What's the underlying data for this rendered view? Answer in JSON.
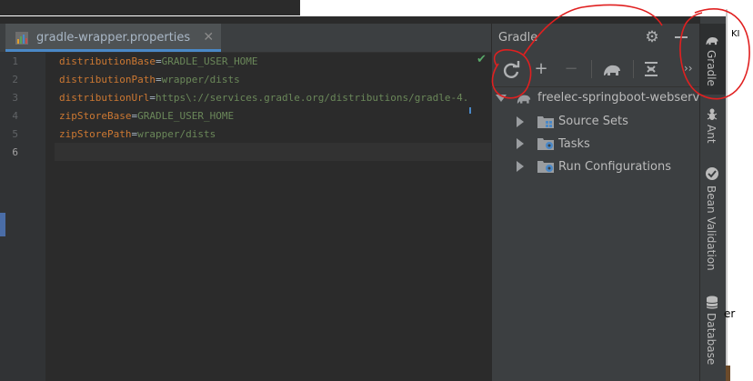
{
  "editor": {
    "tab_label": "gradle-wrapper.properties",
    "lines": [
      {
        "num": "1",
        "key": "distributionBase",
        "eq": "=",
        "value": "GRADLE_USER_HOME"
      },
      {
        "num": "2",
        "key": "distributionPath",
        "eq": "=",
        "value": "wrapper/dists"
      },
      {
        "num": "3",
        "key": "distributionUrl",
        "eq": "=",
        "value": "https\\://services.gradle.org/distributions/gradle-4."
      },
      {
        "num": "4",
        "key": "zipStoreBase",
        "eq": "=",
        "value": "GRADLE_USER_HOME"
      },
      {
        "num": "5",
        "key": "zipStorePath",
        "eq": "=",
        "value": "wrapper/dists"
      },
      {
        "num": "6",
        "key": "",
        "eq": "",
        "value": ""
      }
    ]
  },
  "gradle_panel": {
    "title": "Gradle",
    "toolbar": {
      "refresh_icon": "refresh-icon",
      "add_icon": "plus-icon",
      "remove_icon": "minus-icon",
      "execute_icon": "elephant-icon",
      "collapse_icon": "collapse-all-icon"
    },
    "project": "freelec-springboot-webservice",
    "nodes": [
      "Source Sets",
      "Tasks",
      "Run Configurations"
    ]
  },
  "right_stripe": {
    "more": "››",
    "tabs": [
      "Gradle",
      "Ant",
      "Bean Validation",
      "Database"
    ]
  },
  "external": {
    "label_top": "KI",
    "label_bottom": "er"
  },
  "colors": {
    "accent": "#4a88c7",
    "annotation": "#e02020"
  }
}
